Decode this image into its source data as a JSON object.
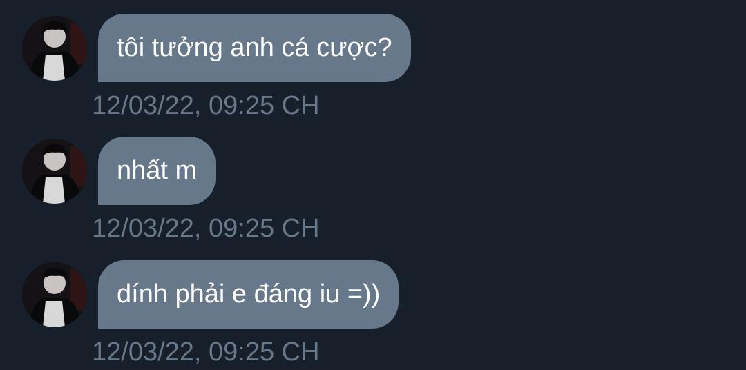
{
  "colors": {
    "background": "#17202a",
    "bubble": "#66788a",
    "bubble_text": "#ffffff",
    "timestamp_text": "#66788a"
  },
  "messages": [
    {
      "text": "tôi tưởng anh cá cược?",
      "timestamp": "12/03/22, 09:25 CH",
      "avatar_icon": "user-avatar-icon"
    },
    {
      "text": "nhất m",
      "timestamp": "12/03/22, 09:25 CH",
      "avatar_icon": "user-avatar-icon"
    },
    {
      "text": "dính phải e đáng iu =))",
      "timestamp": "12/03/22, 09:25 CH",
      "avatar_icon": "user-avatar-icon"
    }
  ]
}
